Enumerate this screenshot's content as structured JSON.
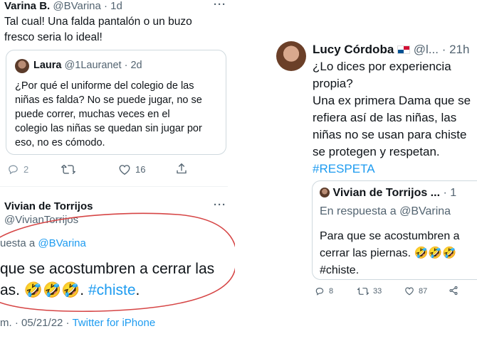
{
  "left": {
    "tweet1": {
      "author_name": "Varina B.",
      "handle_time": "@BVarina · 1d",
      "text_line1": "Tal cual! Una falda pantalón o un buzo",
      "text_line2": "fresco seria lo ideal!",
      "quote": {
        "author_name": "Laura",
        "handle_time": "@1Lauranet · 2d",
        "lines": [
          "¿Por qué el uniforme del colegio de las",
          "niñas es falda? No se puede jugar, no se",
          "puede correr, muchas veces en el",
          "colegio las niñas se quedan sin jugar por",
          "eso, no es cómodo."
        ]
      },
      "actions": {
        "replies": "2",
        "retweets": "",
        "likes": "16",
        "share": ""
      }
    },
    "tweet2": {
      "author_name": "Vivian de Torrijos",
      "handle": "@VivianTorrijos",
      "reply_prefix": "uesta a ",
      "reply_handle": "@BVarina",
      "text_line1": "que se acostumbren a cerrar las",
      "text_line2_prefix": "as. 🤣🤣🤣. ",
      "hashtag": "#chiste",
      "text_line2_suffix": ".",
      "meta_time": "m. · 05/21/22 · ",
      "meta_source": "Twitter for iPhone"
    }
  },
  "right": {
    "tweet": {
      "author_name": "Lucy Córdoba",
      "handle_time": "@l... · 21h",
      "lines": [
        "¿Lo dices por experiencia",
        "propia?",
        "Una ex primera Dama que se",
        "refiera así de las niñas, las",
        "niñas no se usan para chiste",
        "se protegen y respetan."
      ],
      "hashtag": "#RESPETA",
      "quote": {
        "author_name": "Vivian de Torrijos ...",
        "time": "· 1",
        "reply_line": "En respuesta a @BVarina",
        "lines": [
          "Para que se acostumbren a",
          "cerrar las piernas. 🤣🤣🤣",
          "#chiste."
        ]
      },
      "actions": {
        "replies": "8",
        "retweets": "33",
        "likes": "87"
      }
    }
  },
  "colors": {
    "link": "#1d9bf0",
    "muted": "#536471",
    "annotation_circle": "#d64545",
    "card_border": "#cfd9de"
  }
}
